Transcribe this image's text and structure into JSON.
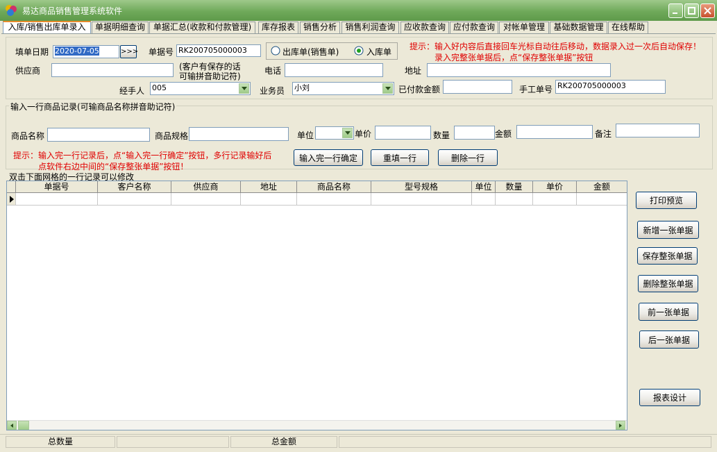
{
  "window": {
    "title": "易达商品销售管理系统软件",
    "colors": {
      "titlebar": "#6FA95A",
      "hint": "#E00000",
      "date_selected": "#316AC5"
    }
  },
  "tabs": [
    {
      "label": "入库/销售出库单录入",
      "active": true
    },
    {
      "label": "单据明细查询"
    },
    {
      "label": "单据汇总(收款和付款管理)"
    },
    {
      "label": "库存报表"
    },
    {
      "label": "销售分析"
    },
    {
      "label": "销售利润查询"
    },
    {
      "label": "应收款查询"
    },
    {
      "label": "应付款查询"
    },
    {
      "label": "对帐单管理"
    },
    {
      "label": "基础数据管理"
    },
    {
      "label": "在线帮助"
    }
  ],
  "header_form": {
    "date_label": "填单日期",
    "date_value": "2020-07-05",
    "date_btn": ">>>",
    "doc_no_label": "单据号",
    "doc_no_value": "RK200705000003",
    "radio_out": "出库单(销售单)",
    "radio_in": "入库单",
    "selected_type": "入库单",
    "hint_line1": "提示：输入好内容后直接回车光标自动往后移动，数据录入过一次后自动保存！",
    "hint_line2": "录入完整张单据后，点“保存整张单据”按钮",
    "supplier_label": "供应商",
    "supplier_value": "",
    "supplier_note1": "(客户有保存的话",
    "supplier_note2": "可输拼音助记符)",
    "phone_label": "电话",
    "phone_value": "",
    "address_label": "地址",
    "address_value": "",
    "handler_label": "经手人",
    "handler_value": "005",
    "salesman_label": "业务员",
    "salesman_value": "小刘",
    "paid_label": "已付款金额",
    "paid_value": "",
    "manual_no_label": "手工单号",
    "manual_no_value": "RK200705000003"
  },
  "line_form": {
    "group_title": "输入一行商品记录(可输商品名称拼音助记符)",
    "name_label": "商品名称",
    "spec_label": "商品规格",
    "unit_label": "单位",
    "price_label": "单价",
    "qty_label": "数量",
    "amount_label": "金额",
    "note_label": "备注",
    "hint_line1": "提示：输入完一行记录后，点“输入完一行确定”按钮，多行记录输好后",
    "hint_line2": "点软件右边中间的“保存整张单据”按钮！",
    "confirm_btn": "输入完一行确定",
    "refill_btn": "重填一行",
    "delete_row_btn": "删除一行"
  },
  "grid": {
    "caption": "双击下面网格的一行记录可以修改",
    "columns": [
      "单据号",
      "客户名称",
      "供应商",
      "地址",
      "商品名称",
      "型号规格",
      "单位",
      "数量",
      "单价",
      "金额"
    ],
    "rows": []
  },
  "side_buttons": {
    "print_preview": "打印预览",
    "new_doc": "新增一张单据",
    "save_doc": "保存整张单据",
    "delete_doc": "删除整张单据",
    "prev_doc": "前一张单据",
    "next_doc": "后一张单据",
    "report_design": "报表设计"
  },
  "status": {
    "total_qty_label": "总数量",
    "total_amount_label": "总金额"
  }
}
